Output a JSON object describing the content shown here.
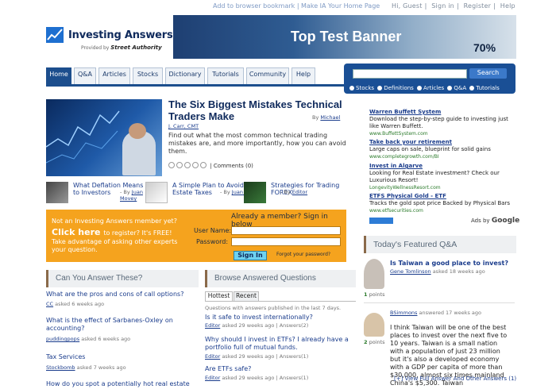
{
  "topbar": {
    "bookmark": "Add to browser bookmark | Make IA Your Home Page",
    "greeting": "Hi, Guest",
    "signin": "Sign in",
    "register": "Register",
    "help": "Help"
  },
  "logo": {
    "brand": "Investing Answers",
    "provided_by": "Provided by",
    "street": "Street Authority"
  },
  "banner": {
    "title": "Top Test Banner",
    "percent": "70%"
  },
  "nav": {
    "tabs": [
      "Home",
      "Q&A",
      "Articles",
      "Stocks",
      "Dictionary",
      "Tutorials",
      "Community",
      "Help"
    ]
  },
  "search": {
    "button": "Search",
    "options": [
      "Stocks",
      "Definitions",
      "Articles",
      "Q&A",
      "Tutorials"
    ]
  },
  "feature": {
    "title": "The Six Biggest Mistakes Technical Traders Make",
    "by": "By",
    "author1": "Michael",
    "author2": "J. Carr, CMT",
    "desc": "Find out what the most common technical trading mistakes are, and more importantly, how you can avoid them.",
    "comments": "| Comments (0)"
  },
  "mini": [
    {
      "title": "What Deflation Means to Investors",
      "by": "- By",
      "author": "Juan Movey"
    },
    {
      "title": "A Simple Plan to Avoid Estate Taxes",
      "by": "- By",
      "author": "Juan Movey"
    },
    {
      "title": "Strategies for Trading FOREX",
      "by": "- By",
      "author": "Editor"
    }
  ],
  "member": {
    "line1": "Not an Investing Answers member yet?",
    "click": "Click here",
    "to_register": "to register? It's FREE!",
    "line3": "Take advantage of asking other experts your question.",
    "heading": "Already a member? Sign in below",
    "user_label": "User Name:",
    "pass_label": "Password:",
    "signin": "Sign In",
    "forgot": "Forgot your password?"
  },
  "can_answer": {
    "heading": "Can You Answer These?",
    "items": [
      {
        "q": "What are the pros and cons of call options?",
        "user": "CC",
        "meta": "asked 6 weeks ago"
      },
      {
        "q": "What is the effect of Sarbanes-Oxley on accounting?",
        "user": "puddingpops",
        "meta": "asked 6 weeks ago"
      },
      {
        "q": "Tax Services",
        "user": "Stockbomb",
        "meta": "asked 7 weeks ago"
      },
      {
        "q": "How do you spot a potentially hot real estate"
      }
    ]
  },
  "browse": {
    "heading": "Browse Answered Questions",
    "tab_hottest": "Hottest",
    "tab_recent": "Recent",
    "subtitle": "Questions with answers published in the last 7 days.",
    "items": [
      {
        "q": "Is it safe to invest internationally?",
        "user": "Editor",
        "meta": "asked 29 weeks ago | Answers(2)"
      },
      {
        "q": "Why should I invest in ETFs? I already have a portfolio full of mutual funds.",
        "user": "Editor",
        "meta": "asked 29 weeks ago | Answers(1)"
      },
      {
        "q": "Are ETFs safe?",
        "user": "Editor",
        "meta": "asked 29 weeks ago | Answers(1)"
      }
    ]
  },
  "ads": [
    {
      "title": "Warren Buffett System",
      "text": "Download the step-by-step guide to investing just like Warren Buffett.",
      "url": "www.BuffettSystem.com"
    },
    {
      "title": "Take back your retirement",
      "text": "Large caps on sale, blueprint for solid gains",
      "url": "www.completegrowth.com/BI"
    },
    {
      "title": "Invest in Algarve",
      "text": "Looking for Real Estate investment? Check our Luxurious Resort!",
      "url": "LongevityWellnessResort.com"
    },
    {
      "title": "ETFS Physical Gold - ETF",
      "text": "Tracks the gold spot price Backed by Physical Bars",
      "url": "www.etfsecurities.com"
    }
  ],
  "ads_by": "Ads by",
  "google": "Google",
  "featured": {
    "heading": "Today's Featured Q&A",
    "question": "Is Taiwan a good place to invest?",
    "asker": "Gene Tomlinson",
    "asked": "asked 18 weeks ago",
    "points1": "1",
    "points_label": "points",
    "answerer": "BSimmons",
    "answered": "answered 17 weeks ago",
    "points2": "2",
    "answer": "I think Taiwan will be one of the best places to invest over the next five to 10 years. Taiwan is a small nation with a population of just 23 million but it's also a developed economy with a GDP per capita of more than $30,000, almost six times mainland China's $5,300. Taiwan",
    "more": "[+] View Full Answer And Other Answers (1)"
  }
}
